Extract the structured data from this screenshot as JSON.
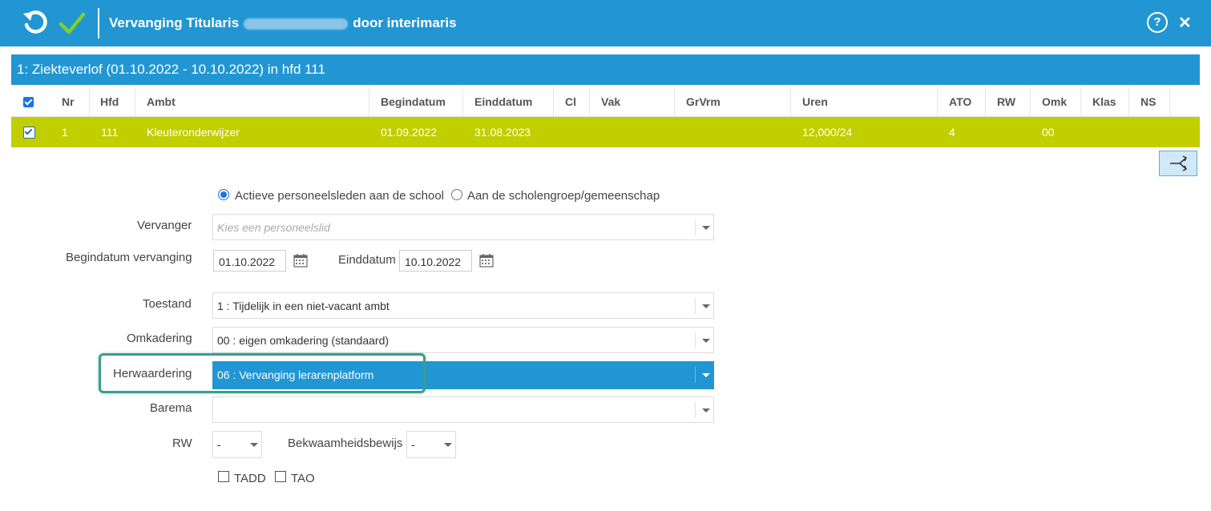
{
  "titlebar": {
    "title_prefix": "Vervanging Titularis",
    "title_suffix": "door interimaris",
    "help": "?",
    "close": "✕"
  },
  "section": {
    "title": "1: Ziekteverlof (01.10.2022 - 10.10.2022) in hfd 111"
  },
  "grid": {
    "headers": [
      "Nr",
      "Hfd",
      "Ambt",
      "Begindatum",
      "Einddatum",
      "Cl",
      "Vak",
      "GrVrm",
      "Uren",
      "ATO",
      "RW",
      "Omk",
      "Klas",
      "NS"
    ],
    "row": {
      "nr": "1",
      "hfd": "111",
      "ambt": "Kleuteronderwijzer",
      "begindatum": "01.09.2022",
      "einddatum": "31.08.2023",
      "uren": "12,000/24",
      "ato": "4",
      "omk": "00"
    }
  },
  "form": {
    "radio_active": "Actieve personeelsleden aan de school",
    "radio_group": "Aan de scholengroep/gemeenschap",
    "vervanger_label": "Vervanger",
    "vervanger_placeholder": "Kies een personeelslid",
    "begindatum_label": "Begindatum vervanging",
    "begindatum_value": "01.10.2022",
    "einddatum_label": "Einddatum",
    "einddatum_value": "10.10.2022",
    "toestand_label": "Toestand",
    "toestand_value": "1 : Tijdelijk in een niet-vacant ambt",
    "omkadering_label": "Omkadering",
    "omkadering_value": "00 : eigen omkadering (standaard)",
    "herwaardering_label": "Herwaardering",
    "herwaardering_value": "06 : Vervanging lerarenplatform",
    "barema_label": "Barema",
    "barema_value": "",
    "rw_label": "RW",
    "rw_value": "-",
    "bekwaam_label": "Bekwaamheidsbewijs",
    "bekwaam_value": "-",
    "tadd_label": "TADD",
    "tao_label": "TAO"
  },
  "colors": {
    "primary": "#2196d3",
    "row_selected": "#c1cf00",
    "highlight": "#3a9e8a",
    "check": "#7ed321"
  }
}
